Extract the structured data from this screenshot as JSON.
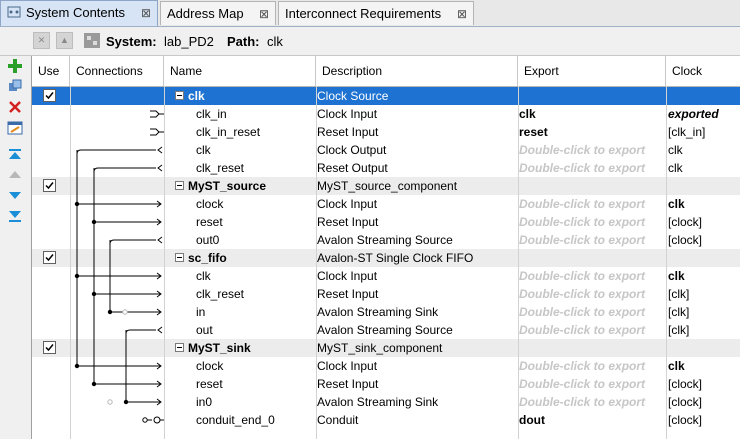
{
  "tabs": [
    {
      "label": "System Contents",
      "close": "⊠",
      "active": true
    },
    {
      "label": "Address Map",
      "close": "⊠",
      "active": false
    },
    {
      "label": "Interconnect Requirements",
      "close": "⊠",
      "active": false
    }
  ],
  "toolbar": {
    "system_label": "System:",
    "system_value": "lab_PD2",
    "path_label": "Path:",
    "path_value": "clk"
  },
  "sidebar_icons": [
    "add-icon",
    "add-component-icon",
    "remove-icon",
    "edit-icon",
    "move-top-icon",
    "move-up-icon",
    "move-down-icon",
    "move-bottom-icon"
  ],
  "columns": [
    "Use",
    "Connections",
    "Name",
    "Description",
    "Export",
    "Clock"
  ],
  "placeholder": "Double-click to export",
  "rows": [
    {
      "type": "component",
      "use": true,
      "name": "clk",
      "desc": "Clock Source",
      "export": "",
      "clock": "",
      "selected": true
    },
    {
      "type": "iface",
      "name": "clk_in",
      "desc": "Clock Input",
      "export": "clk",
      "export_style": "bold",
      "clock": "exported",
      "clock_style": "bi"
    },
    {
      "type": "iface",
      "name": "clk_in_reset",
      "desc": "Reset Input",
      "export": "reset",
      "export_style": "bold",
      "clock": "[clk_in]"
    },
    {
      "type": "iface",
      "name": "clk",
      "desc": "Clock Output",
      "export": "Double-click to export",
      "export_style": "ph",
      "clock": "clk"
    },
    {
      "type": "iface",
      "name": "clk_reset",
      "desc": "Reset Output",
      "export": "Double-click to export",
      "export_style": "ph",
      "clock": "clk"
    },
    {
      "type": "component",
      "use": true,
      "name": "MyST_source",
      "desc": "MyST_source_component",
      "export": "",
      "clock": ""
    },
    {
      "type": "iface",
      "name": "clock",
      "desc": "Clock Input",
      "export": "Double-click to export",
      "export_style": "ph",
      "clock": "clk",
      "clock_style": "bold"
    },
    {
      "type": "iface",
      "name": "reset",
      "desc": "Reset Input",
      "export": "Double-click to export",
      "export_style": "ph",
      "clock": "[clock]"
    },
    {
      "type": "iface",
      "name": "out0",
      "desc": "Avalon Streaming Source",
      "export": "Double-click to export",
      "export_style": "ph",
      "clock": "[clock]"
    },
    {
      "type": "component",
      "use": true,
      "name": "sc_fifo",
      "desc": "Avalon-ST Single Clock FIFO",
      "export": "",
      "clock": ""
    },
    {
      "type": "iface",
      "name": "clk",
      "desc": "Clock Input",
      "export": "Double-click to export",
      "export_style": "ph",
      "clock": "clk",
      "clock_style": "bold"
    },
    {
      "type": "iface",
      "name": "clk_reset",
      "desc": "Reset Input",
      "export": "Double-click to export",
      "export_style": "ph",
      "clock": "[clk]"
    },
    {
      "type": "iface",
      "name": "in",
      "desc": "Avalon Streaming Sink",
      "export": "Double-click to export",
      "export_style": "ph",
      "clock": "[clk]"
    },
    {
      "type": "iface",
      "name": "out",
      "desc": "Avalon Streaming Source",
      "export": "Double-click to export",
      "export_style": "ph",
      "clock": "[clk]"
    },
    {
      "type": "component",
      "use": true,
      "name": "MyST_sink",
      "desc": "MyST_sink_component",
      "export": "",
      "clock": ""
    },
    {
      "type": "iface",
      "name": "clock",
      "desc": "Clock Input",
      "export": "Double-click to export",
      "export_style": "ph",
      "clock": "clk",
      "clock_style": "bold"
    },
    {
      "type": "iface",
      "name": "reset",
      "desc": "Reset Input",
      "export": "Double-click to export",
      "export_style": "ph",
      "clock": "[clock]"
    },
    {
      "type": "iface",
      "name": "in0",
      "desc": "Avalon Streaming Sink",
      "export": "Double-click to export",
      "export_style": "ph",
      "clock": "[clock]"
    },
    {
      "type": "iface",
      "name": "conduit_end_0",
      "desc": "Conduit",
      "export": "dout",
      "export_style": "bold",
      "clock": "[clock]"
    }
  ],
  "colors": {
    "selection": "#1e73d2",
    "alt_row": "#ececec",
    "tab_active": "#d6e4f5",
    "placeholder": "#c6c6c6",
    "add": "#2aa02a",
    "remove": "#d42020",
    "arrow_blue": "#1a8fd8"
  }
}
